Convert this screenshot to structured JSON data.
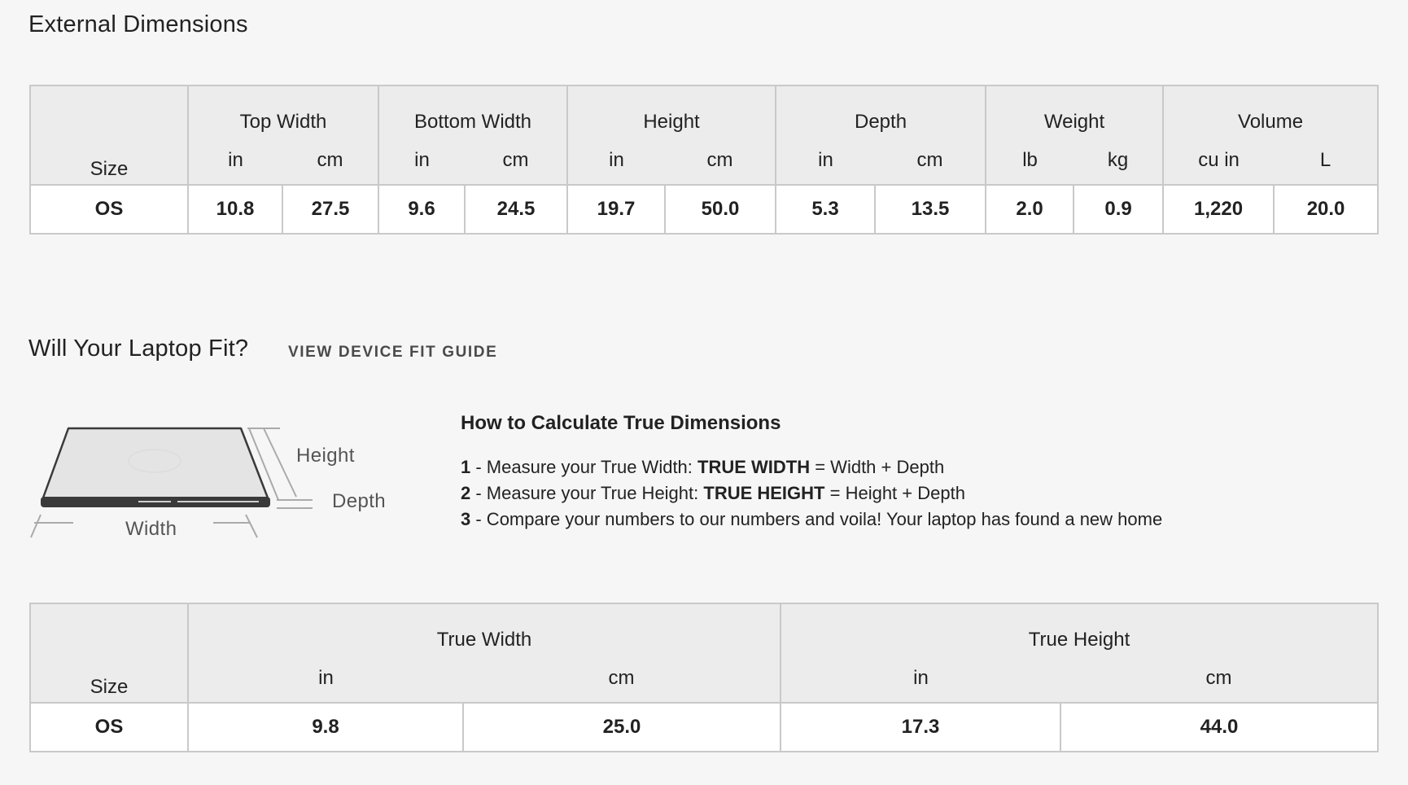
{
  "external": {
    "title": "External Dimensions",
    "size_header": "Size",
    "groups": [
      {
        "label": "Top Width",
        "units": [
          "in",
          "cm"
        ]
      },
      {
        "label": "Bottom Width",
        "units": [
          "in",
          "cm"
        ]
      },
      {
        "label": "Height",
        "units": [
          "in",
          "cm"
        ]
      },
      {
        "label": "Depth",
        "units": [
          "in",
          "cm"
        ]
      },
      {
        "label": "Weight",
        "units": [
          "lb",
          "kg"
        ]
      },
      {
        "label": "Volume",
        "units": [
          "cu in",
          "L"
        ]
      }
    ],
    "row": {
      "size": "OS",
      "values": [
        "10.8",
        "27.5",
        "9.6",
        "24.5",
        "19.7",
        "50.0",
        "5.3",
        "13.5",
        "2.0",
        "0.9",
        "1,220",
        "20.0"
      ]
    }
  },
  "fit": {
    "title": "Will Your Laptop Fit?",
    "guide_link": "VIEW DEVICE FIT GUIDE",
    "diagram": {
      "height_label": "Height",
      "depth_label": "Depth",
      "width_label": "Width"
    },
    "calc_title": "How to Calculate True Dimensions",
    "steps": [
      {
        "num": "1",
        "prefix": " - Measure your True Width: ",
        "bold": "TRUE WIDTH",
        "suffix": " = Width + Depth"
      },
      {
        "num": "2",
        "prefix": " - Measure your True Height: ",
        "bold": "TRUE HEIGHT",
        "suffix": " = Height + Depth"
      },
      {
        "num": "3",
        "prefix": " - Compare your numbers to our numbers and voila! Your laptop has found a new home",
        "bold": "",
        "suffix": ""
      }
    ]
  },
  "true_dims": {
    "size_header": "Size",
    "groups": [
      {
        "label": "True Width",
        "units": [
          "in",
          "cm"
        ]
      },
      {
        "label": "True Height",
        "units": [
          "in",
          "cm"
        ]
      }
    ],
    "row": {
      "size": "OS",
      "values": [
        "9.8",
        "25.0",
        "17.3",
        "44.0"
      ]
    }
  },
  "colors": {
    "background": "#f6f6f6",
    "header_bg": "#ececec",
    "cell_bg": "#ffffff",
    "border": "#c9c9c9",
    "text": "#222222",
    "link": "#4a4a4a"
  }
}
